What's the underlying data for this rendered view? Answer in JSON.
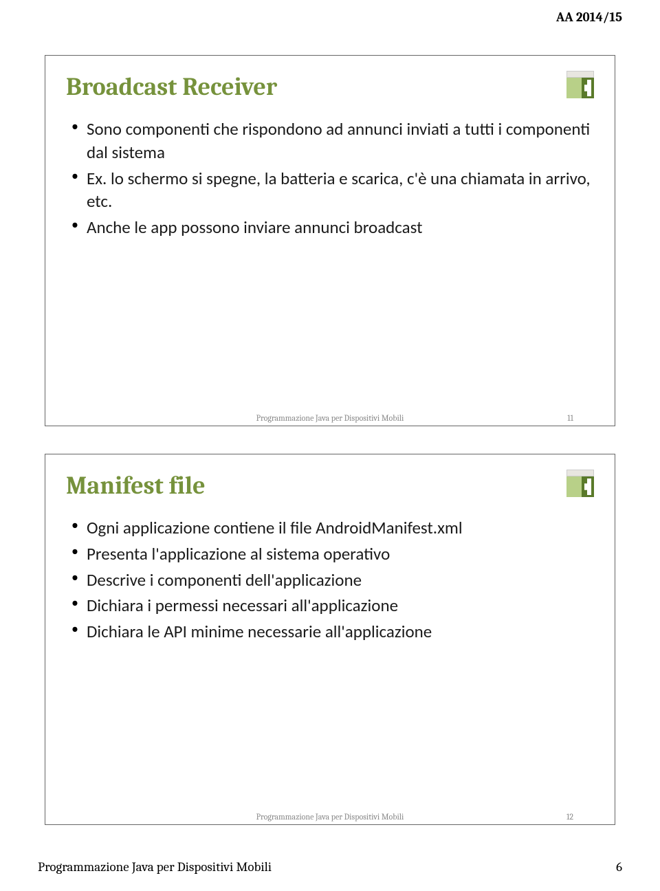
{
  "header": "AA 2014/15",
  "slides": [
    {
      "title": "Broadcast Receiver",
      "bullets": [
        "Sono componenti che rispondono ad annunci inviati a tutti i componenti dal sistema",
        "Ex. lo schermo si spegne, la batteria e scarica, c'è una chiamata in arrivo, etc.",
        "Anche le app possono inviare annunci broadcast"
      ],
      "footer_label": "Programmazione Java per Dispositivi Mobili",
      "footer_num": "11"
    },
    {
      "title": "Manifest file",
      "bullets": [
        "Ogni applicazione contiene il file AndroidManifest.xml",
        "Presenta l'applicazione al sistema operativo",
        "Descrive i componenti dell'applicazione",
        "Dichiara i permessi necessari all'applicazione",
        "Dichiara le API minime necessarie all'applicazione"
      ],
      "footer_label": "Programmazione Java per Dispositivi Mobili",
      "footer_num": "12"
    }
  ],
  "page_footer": {
    "label": "Programmazione Java per Dispositivi Mobili",
    "num": "6"
  }
}
